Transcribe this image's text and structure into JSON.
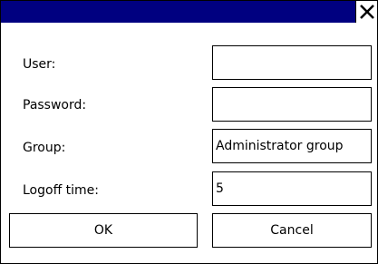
{
  "titlebar": {
    "close_icon": "close-icon"
  },
  "form": {
    "user_label": "User:",
    "user_value": "",
    "password_label": "Password:",
    "password_value": "",
    "group_label": "Group:",
    "group_value": "Administrator group",
    "logoff_label": "Logoff time:",
    "logoff_value": "5"
  },
  "buttons": {
    "ok_label": "OK",
    "cancel_label": "Cancel"
  },
  "colors": {
    "titlebar": "#000080",
    "background": "#ffffff",
    "border": "#000000"
  }
}
